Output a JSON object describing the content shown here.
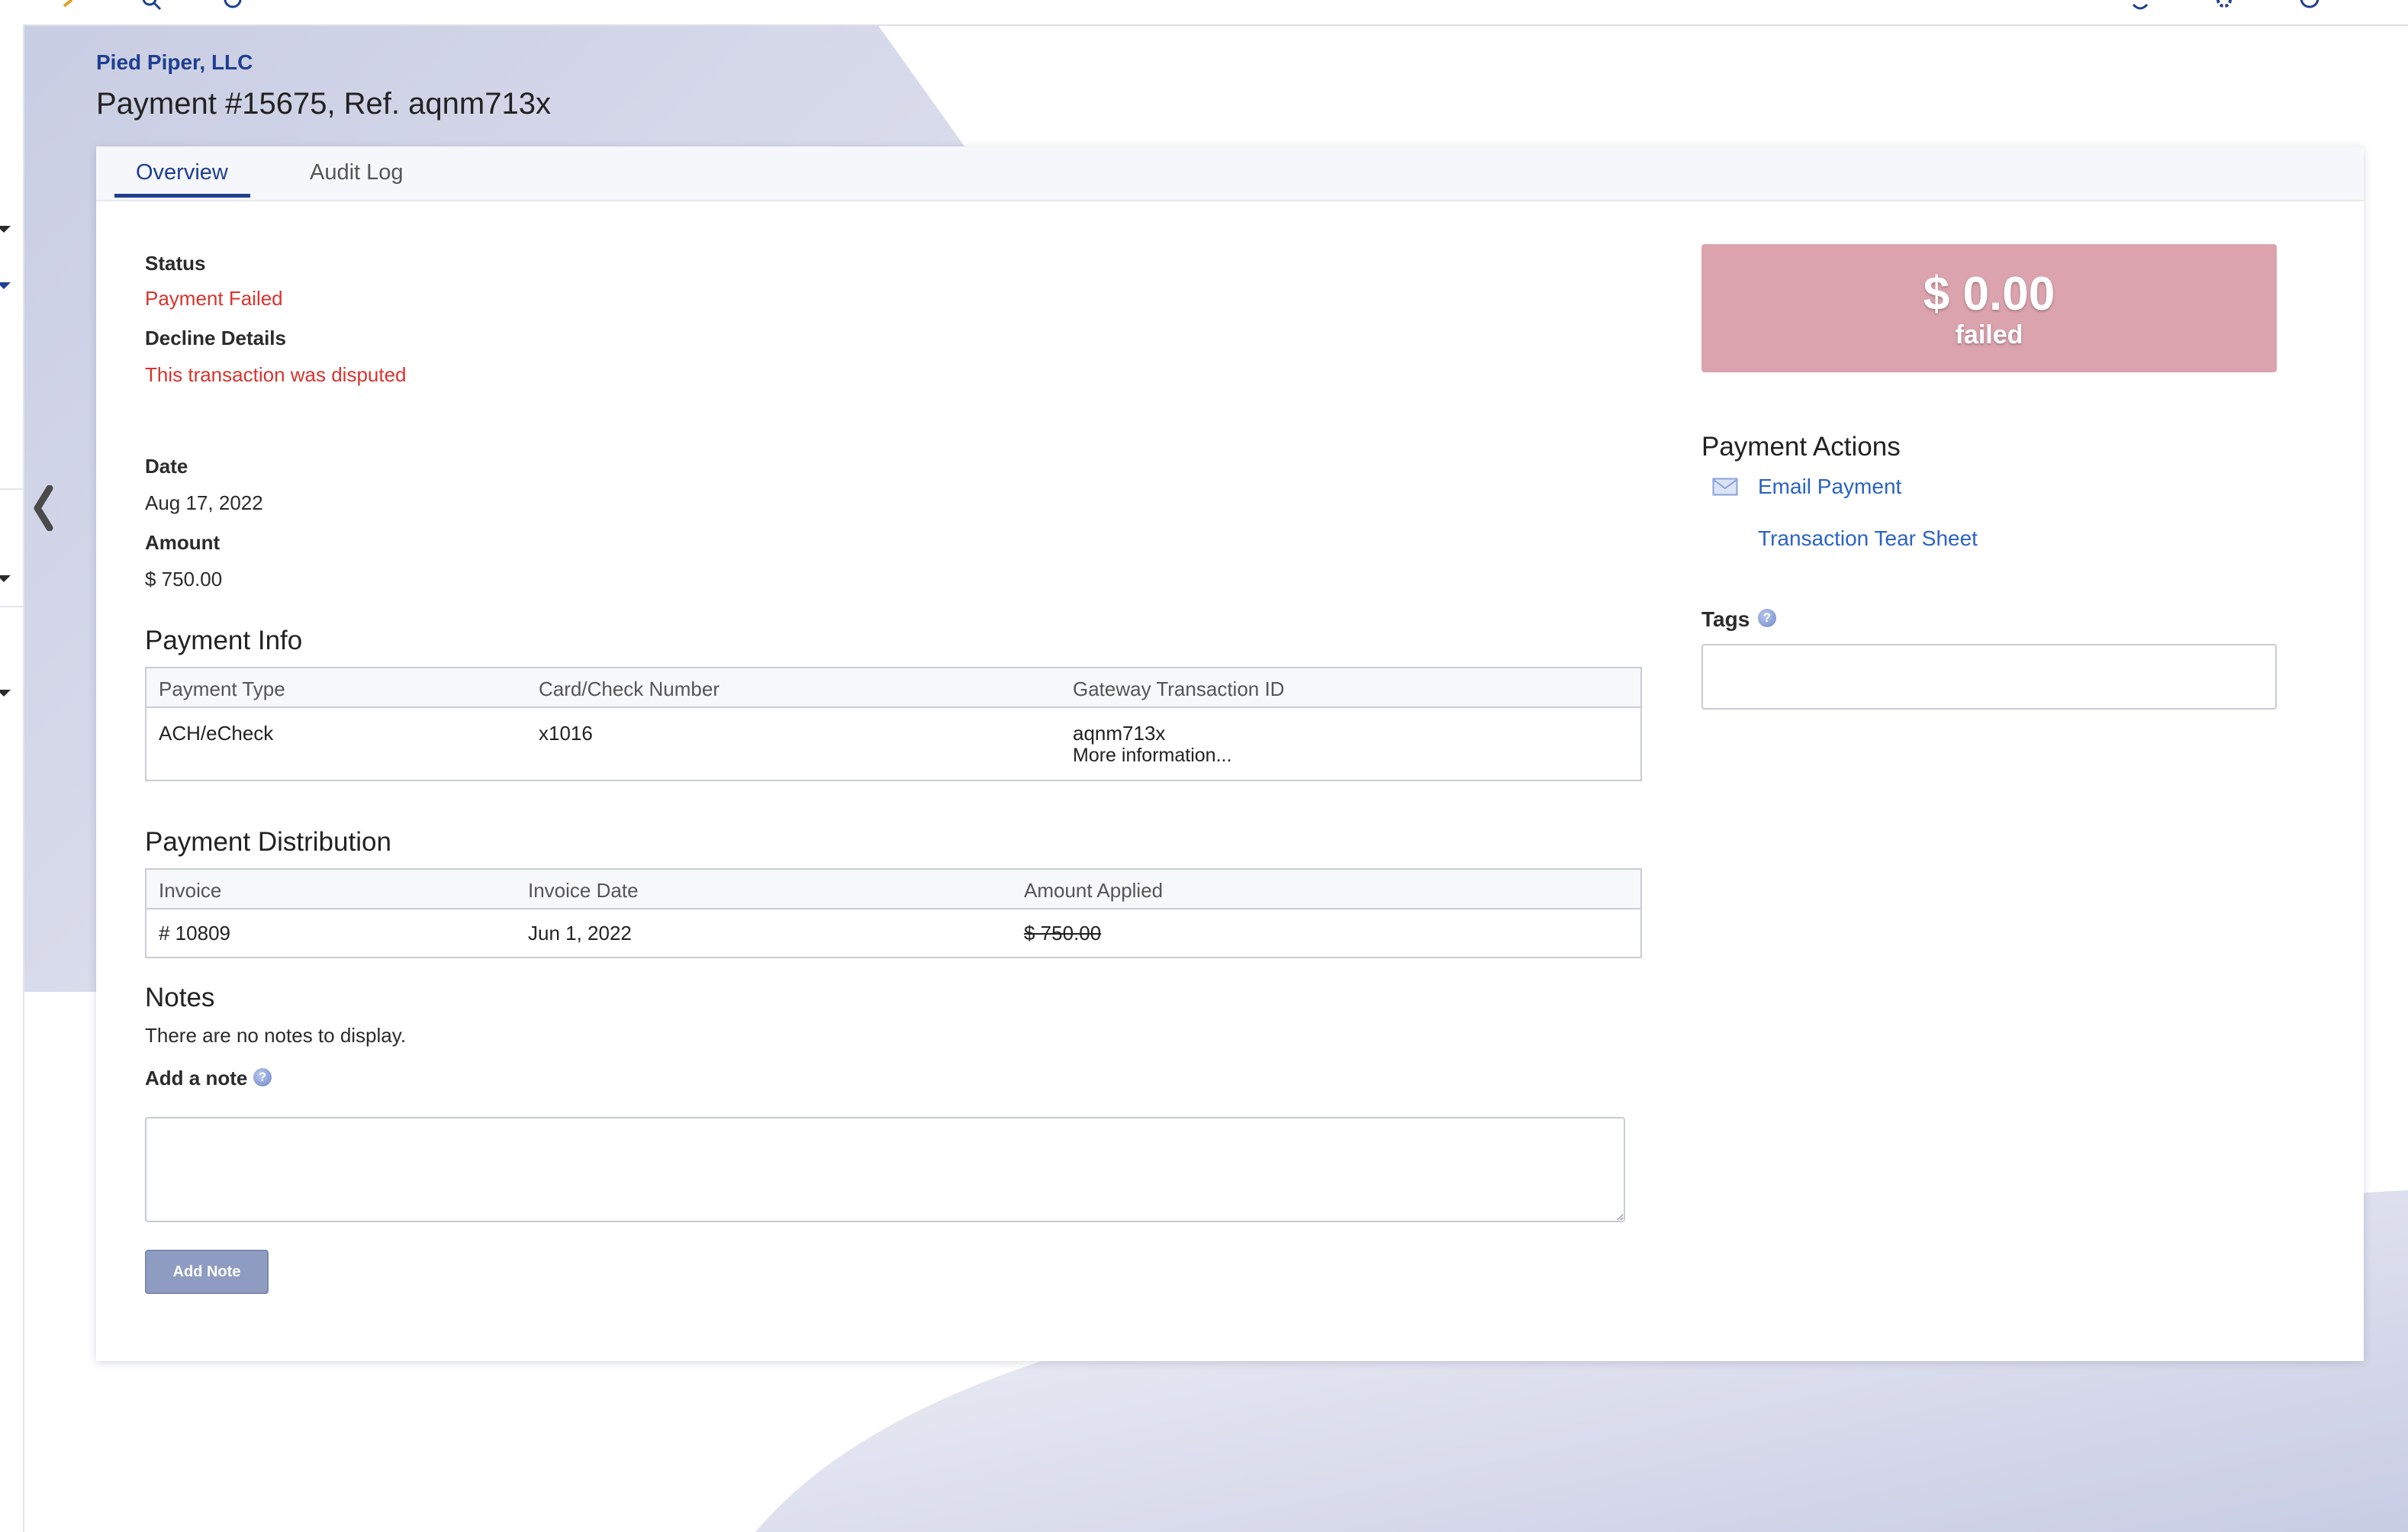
{
  "header": {
    "company": "Pied Piper, LLC",
    "title": "Payment #15675, Ref. aqnm713x"
  },
  "tabs": [
    {
      "label": "Overview",
      "active": true
    },
    {
      "label": "Audit Log",
      "active": false
    }
  ],
  "status": {
    "label": "Status",
    "value": "Payment Failed",
    "decline_label": "Decline Details",
    "decline_value": "This transaction was disputed"
  },
  "details": {
    "date_label": "Date",
    "date_value": "Aug 17, 2022",
    "amount_label": "Amount",
    "amount_value": "$ 750.00"
  },
  "payment_info": {
    "title": "Payment Info",
    "columns": [
      "Payment Type",
      "Card/Check Number",
      "Gateway Transaction ID"
    ],
    "row": {
      "payment_type": "ACH/eCheck",
      "card_number": "x1016",
      "gateway_id": "aqnm713x",
      "more_link": "More information..."
    }
  },
  "distribution": {
    "title": "Payment Distribution",
    "columns": [
      "Invoice",
      "Invoice Date",
      "Amount Applied"
    ],
    "row": {
      "invoice": "# 10809",
      "invoice_date": "Jun 1, 2022",
      "amount_applied": "$ 750.00"
    }
  },
  "notes": {
    "title": "Notes",
    "empty_text": "There are no notes to display.",
    "add_label": "Add a note",
    "button": "Add Note",
    "placeholder": ""
  },
  "summary": {
    "amount": "$ 0.00",
    "state": "failed",
    "box_color": "#dba3ad"
  },
  "actions": {
    "title": "Payment Actions",
    "email": "Email Payment",
    "tear_sheet": "Transaction Tear Sheet"
  },
  "tags": {
    "label": "Tags",
    "help": "?"
  },
  "help_glyph": "?",
  "colors": {
    "brand": "#1f3f8f",
    "link": "#2b62c4",
    "error": "#d9332e"
  }
}
